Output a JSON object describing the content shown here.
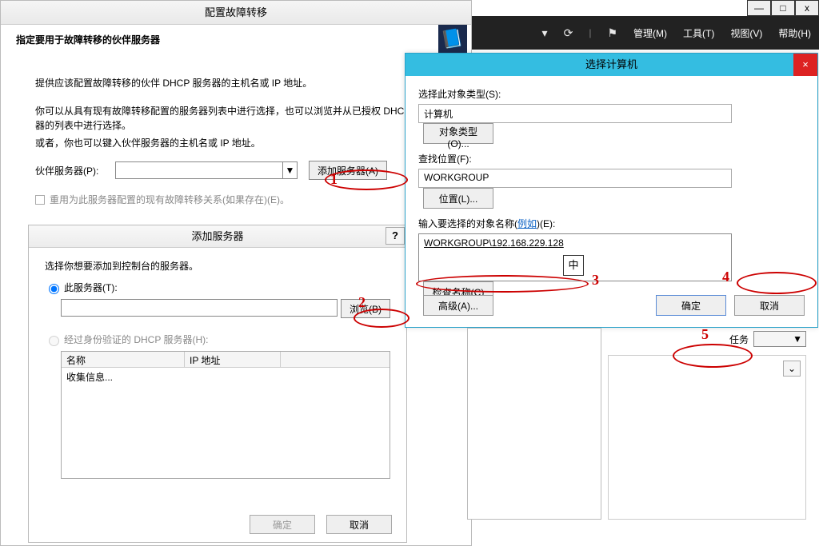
{
  "cap": {
    "min": "—",
    "close_x": "x",
    "max": "□"
  },
  "menubar": {
    "refresh": "⟳",
    "flag": "⚑",
    "arrow": "▾",
    "sep": "|",
    "manage": "管理(M)",
    "tools": "工具(T)",
    "view": "视图(V)",
    "help": "帮助(H)"
  },
  "win1": {
    "title": "配置故障转移",
    "header": "指定要用于故障转移的伙伴服务器",
    "instr1": "提供应该配置故障转移的伙伴 DHCP 服务器的主机名或 IP 地址。",
    "instr2": "你可以从具有现有故障转移配置的服务器列表中进行选择，也可以浏览并从已授权 DHCP 服务器的列表中进行选择。",
    "instr3": "或者，你也可以键入伙伴服务器的主机名或 IP 地址。",
    "partner_label": "伙伴服务器(P):",
    "combo_value": "",
    "add_server_btn": "添加服务器(A)",
    "reuse_label": "重用为此服务器配置的现有故障转移关系(如果存在)(E)。",
    "dropdown_glyph": "▼"
  },
  "addserver": {
    "title": "添加服务器",
    "help": "?",
    "prompt": "选择你想要添加到控制台的服务器。",
    "opt_this": "此服务器(T):",
    "browse_btn": "浏览(B)",
    "opt_auth": "经过身份验证的 DHCP 服务器(H):",
    "col_name": "名称",
    "col_ip": "IP 地址",
    "gathering": "收集信息...",
    "ok": "确定",
    "cancel": "取消"
  },
  "win2": {
    "title": "选择计算机",
    "close": "×",
    "obj_type_lbl": "选择此对象类型(S):",
    "obj_type_val": "计算机",
    "obj_type_btn": "对象类型(O)...",
    "loc_lbl": "查找位置(F):",
    "loc_val": "WORKGROUP",
    "loc_btn": "位置(L)...",
    "names_lbl_a": "输入要选择的对象名称(",
    "names_lbl_example": "例如",
    "names_lbl_b": ")(E):",
    "names_val": "WORKGROUP\\192.168.229.128",
    "ime": "中",
    "check_btn": "检查名称(C)",
    "adv_btn": "高级(A)...",
    "ok": "确定",
    "cancel": "取消"
  },
  "rightpanel": {
    "tasks_label": "任务",
    "dropdown_glyph": "▼",
    "chevron": "⌄"
  },
  "anno": {
    "n1": "1",
    "n2": "2",
    "n3": "3",
    "n4": "4",
    "n5": "5"
  }
}
